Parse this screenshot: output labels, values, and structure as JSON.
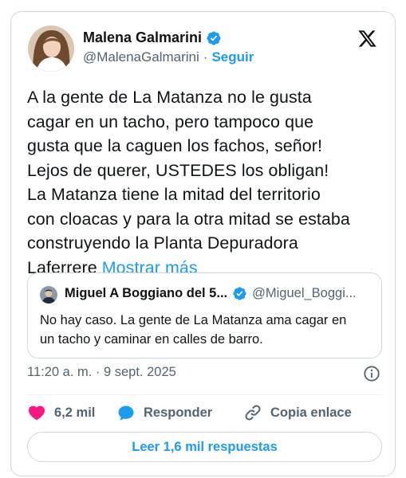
{
  "author": {
    "name": "Malena Galmarini",
    "handle": "@MalenaGalmarini",
    "separator": "·",
    "follow_label": "Seguir"
  },
  "tweet": {
    "lines": [
      "A la gente de La Matanza no le gusta",
      "cagar en un tacho, pero tampoco que",
      "gusta que la caguen los fachos, señor!",
      "Lejos de querer, USTEDES los obligan!",
      "La Matanza tiene la mitad del territorio",
      "con cloacas y para la otra mitad se estaba",
      "construyendo la Planta Depuradora",
      "Laferrere"
    ],
    "show_more": "Mostrar más"
  },
  "quote": {
    "name": "Miguel A Boggiano del 5...",
    "handle": "@Miguel_Boggi...",
    "lines": [
      "No hay caso. La gente de La Matanza ama cagar en",
      "un tacho y caminar en calles de barro."
    ]
  },
  "timestamp": "11:20 a. m. · 9 sept. 2025",
  "actions": {
    "likes": "6,2 mil",
    "reply_label": "Responder",
    "copy_link_label": "Copia enlace"
  },
  "read_replies_label": "Leer 1,6 mil respuestas",
  "icons": [
    "verified-badge-icon",
    "x-logo-icon",
    "info-icon",
    "heart-icon",
    "reply-bubble-icon",
    "link-icon"
  ],
  "colors": {
    "accent": "#1d9bf0",
    "heart": "#f91880",
    "text": "#0f1419",
    "muted": "#536471",
    "border": "#cfd9de"
  }
}
